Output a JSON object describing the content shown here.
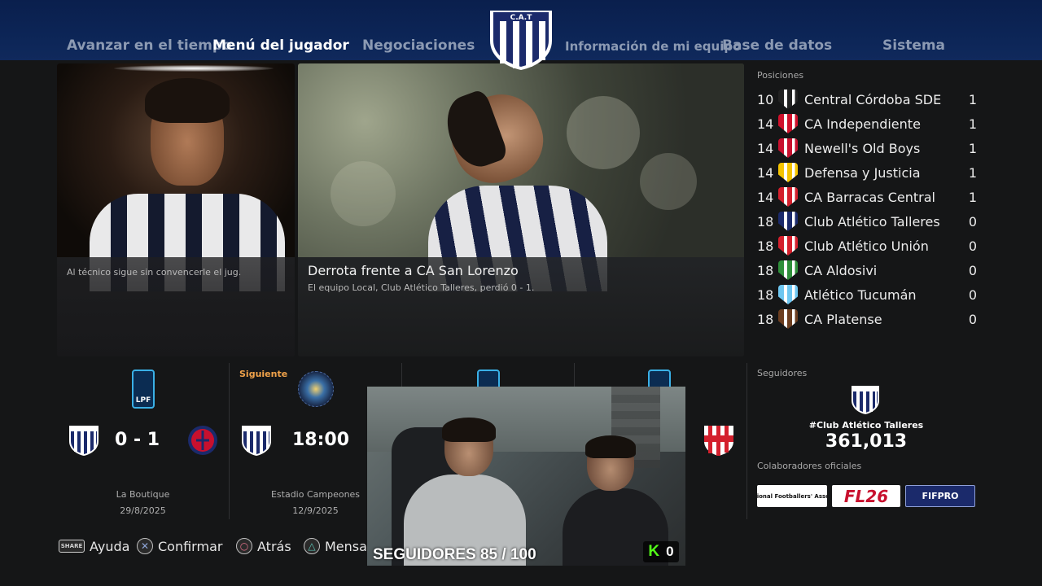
{
  "nav": {
    "items": [
      {
        "label": "Avanzar en el tiempo"
      },
      {
        "label": "Menú del jugador"
      },
      {
        "label": "Negociaciones"
      },
      {
        "label": "Información de mi equipo"
      },
      {
        "label": "Base de datos"
      },
      {
        "label": "Sistema"
      }
    ],
    "active": "Menú del jugador",
    "crest_text": "C.A.T"
  },
  "news": {
    "card_a_caption": "Al técnico sigue sin convencerle el jug.",
    "card_b_headline": "Derrota frente a CA San Lorenzo",
    "card_b_sub": "El equipo Local, Club Atlético Talleres, perdió 0 - 1."
  },
  "standings": {
    "header": "Posiciones",
    "rows": [
      {
        "rank": "10",
        "team": "Central Córdoba SDE",
        "pts": "1",
        "crest_icon": "central-cordoba-crest-icon",
        "color": "#222222"
      },
      {
        "rank": "14",
        "team": "CA Independiente",
        "pts": "1",
        "crest_icon": "independiente-crest-icon",
        "color": "#d0102b"
      },
      {
        "rank": "14",
        "team": "Newell's Old Boys",
        "pts": "1",
        "crest_icon": "newells-crest-icon",
        "color": "#c8102e"
      },
      {
        "rank": "14",
        "team": "Defensa y Justicia",
        "pts": "1",
        "crest_icon": "defensa-crest-icon",
        "color": "#f4c300"
      },
      {
        "rank": "14",
        "team": "CA Barracas Central",
        "pts": "1",
        "crest_icon": "barracas-crest-icon",
        "color": "#d41f2c"
      },
      {
        "rank": "18",
        "team": "Club Atlético Talleres",
        "pts": "0",
        "crest_icon": "talleres-crest-icon",
        "color": "#1b2a6b"
      },
      {
        "rank": "18",
        "team": "Club Atlético Unión",
        "pts": "0",
        "crest_icon": "union-crest-icon",
        "color": "#d41f2c"
      },
      {
        "rank": "18",
        "team": "CA Aldosivi",
        "pts": "0",
        "crest_icon": "aldosivi-crest-icon",
        "color": "#2f8f3a"
      },
      {
        "rank": "18",
        "team": "Atlético Tucumán",
        "pts": "0",
        "crest_icon": "tucuman-crest-icon",
        "color": "#6ec6f0"
      },
      {
        "rank": "18",
        "team": "CA Platense",
        "pts": "0",
        "crest_icon": "platense-crest-icon",
        "color": "#6b3d1f"
      }
    ]
  },
  "fixtures": {
    "next_label": "Siguiente",
    "league_short": "LPF",
    "items": [
      {
        "score": "0  -  1",
        "venue": "La Boutique",
        "date": "29/8/2025"
      },
      {
        "score": "18:00",
        "venue": "Estadio Campeones",
        "date": "12/9/2025"
      }
    ]
  },
  "followers": {
    "label": "Seguidores",
    "club": "#Club Atlético Talleres",
    "count": "361,013",
    "partners_label": "Colaboradores oficiales",
    "partners": [
      {
        "name": "Professional Footballers' Association"
      },
      {
        "name": "FL26"
      },
      {
        "name": "FIFPRO"
      }
    ]
  },
  "bottom": {
    "hints": [
      {
        "glyph": "SHARE",
        "label": "Ayuda"
      },
      {
        "glyph": "✕",
        "label": "Confirmar"
      },
      {
        "glyph": "○",
        "label": "Atrás"
      },
      {
        "glyph": "△",
        "label": "Mensa"
      }
    ]
  },
  "webcam": {
    "followers_text": "SEGUIDORES 85 / 100",
    "kick_letter": "K",
    "kick_count": "0"
  },
  "colors": {
    "nav_bg": "#0d2658",
    "accent_orange": "#f0a24a",
    "talleres_navy": "#1b2a6b"
  }
}
